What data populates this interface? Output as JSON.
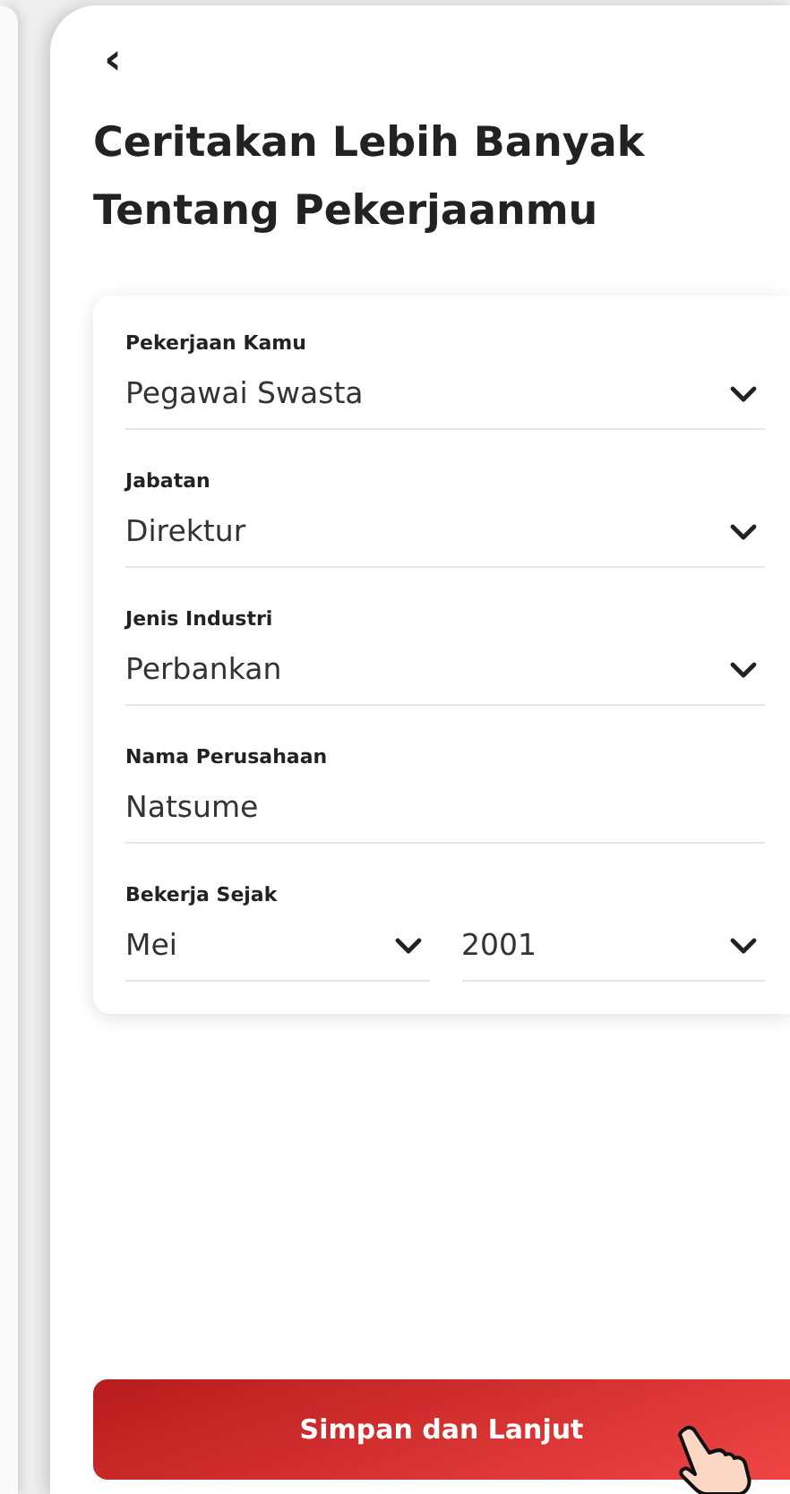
{
  "header": {
    "back_icon": "‹",
    "title": "Ceritakan Lebih Banyak Tentang Pekerjaanmu"
  },
  "fields": [
    {
      "kind": "select",
      "label": "Pekerjaan Kamu",
      "value": "Pegawai Swasta"
    },
    {
      "kind": "select",
      "label": "Jabatan",
      "value": "Direktur"
    },
    {
      "kind": "select",
      "label": "Jenis Industri",
      "value": "Perbankan"
    },
    {
      "kind": "text",
      "label": "Nama Perusahaan",
      "value": "Natsume"
    },
    {
      "kind": "pair",
      "label": "Bekerja Sejak",
      "parts": [
        "Mei",
        "2001"
      ]
    }
  ],
  "submit_button": "Simpan dan Lanjut"
}
